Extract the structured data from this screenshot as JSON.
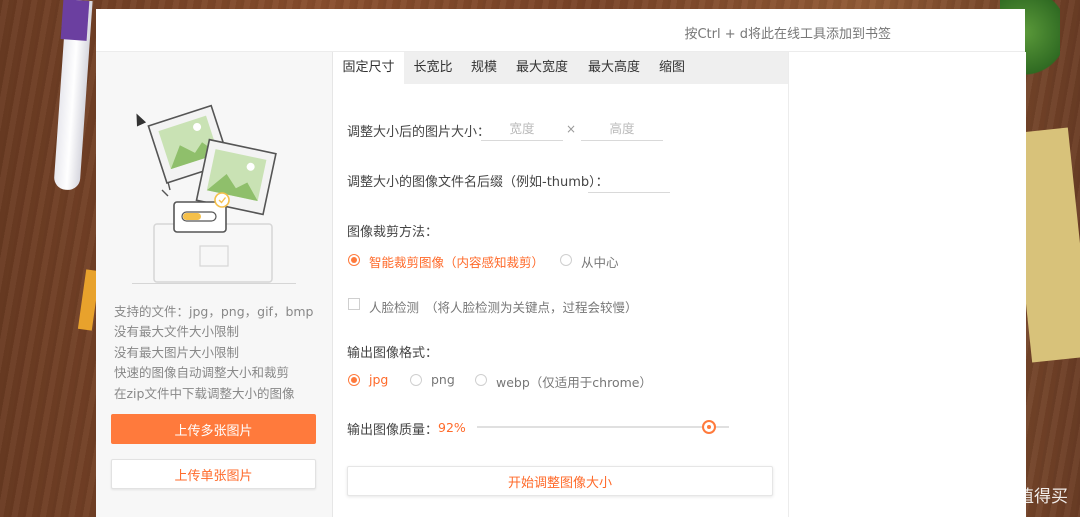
{
  "header": {
    "bookmark_hint": "按Ctrl + d将此在线工具添加到书签"
  },
  "sidebar": {
    "features": [
      "支持的文件：jpg，png，gif，bmp",
      "没有最大文件大小限制",
      "没有最大图片大小限制",
      "快速的图像自动调整大小和裁剪",
      "在zip文件中下载调整大小的图像"
    ],
    "upload_multiple": "上传多张图片",
    "upload_single": "上传单张图片"
  },
  "tabs": [
    {
      "label": "固定尺寸",
      "active": true
    },
    {
      "label": "长宽比",
      "active": false
    },
    {
      "label": "规模",
      "active": false
    },
    {
      "label": "最大宽度",
      "active": false
    },
    {
      "label": "最大高度",
      "active": false
    },
    {
      "label": "缩图",
      "active": false
    }
  ],
  "form": {
    "size_label": "调整大小后的图片大小：",
    "width_placeholder": "宽度",
    "height_placeholder": "高度",
    "times": "×",
    "suffix_label": "调整大小的图像文件名后缀（例如-thumb）：",
    "suffix_value": "",
    "crop_label": "图像裁剪方法：",
    "crop_options": [
      {
        "label": "智能裁剪图像（内容感知裁剪）",
        "checked": true
      },
      {
        "label": "从中心",
        "checked": false
      }
    ],
    "face_detect_label": "人脸检测",
    "face_detect_note": "（将人脸检测为关键点，过程会较慢）",
    "face_detect_checked": false,
    "format_label": "输出图像格式：",
    "format_options": [
      {
        "label": "jpg",
        "checked": true
      },
      {
        "label": "png",
        "checked": false
      },
      {
        "label": "webp（仅适用于chrome）",
        "checked": false
      }
    ],
    "quality_label": "输出图像质量：",
    "quality_value": "92%",
    "quality_fraction": 0.92,
    "start_button": "开始调整图像大小"
  },
  "watermark": {
    "text": "什么值得买"
  },
  "colors": {
    "accent": "#ff7a3c",
    "accent_text": "#ff6a2a",
    "tab_bg": "#efefef",
    "sidebar_bg": "#f7f7f7"
  },
  "icons": {
    "illustration": "image-upload-illustration",
    "cursor": "mouse-pointer-icon",
    "watermark_logo": "smzdm-logo-icon"
  }
}
